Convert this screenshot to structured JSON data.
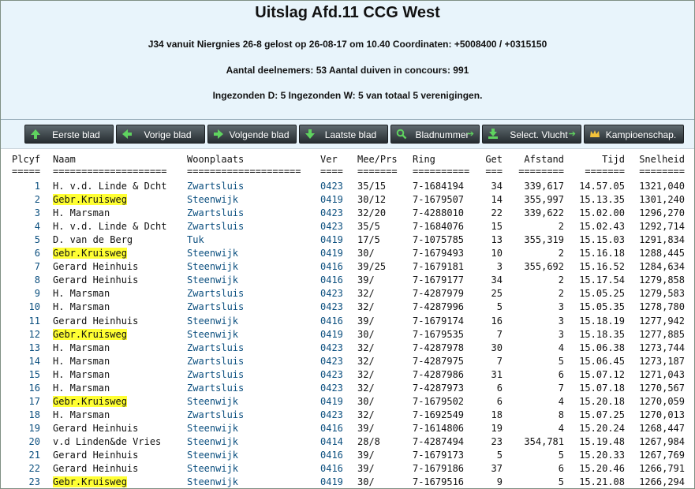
{
  "title": "Uitslag Afd.11 CCG West",
  "info": {
    "line1": "J34 vanuit Niergnies 26-8 gelost op 26-08-17 om 10.40 Coordinaten: +5008400 / +0315150",
    "line2": "Aantal deelnemers: 53 Aantal duiven in concours: 991",
    "line3": "Ingezonden D: 5 Ingezonden W: 5 van totaal 5 verenigingen."
  },
  "nav": {
    "first": "Eerste blad",
    "prev": "Vorige blad",
    "next": "Volgende blad",
    "last": "Laatste blad",
    "page": "Bladnummer",
    "select": "Select. Vlucht",
    "champ": "Kampioenschap."
  },
  "columns": [
    "Plcyf",
    "Naam",
    "Woonplaats",
    "Ver",
    "Mee/Prs",
    "Ring",
    "Get",
    "Afstand",
    "Tijd",
    "Snelheid"
  ],
  "underlines": [
    "=====",
    "====================",
    "====================",
    "====",
    "=======",
    "==========",
    "===",
    "========",
    "=======",
    "========"
  ],
  "rows": [
    [
      "1",
      "H. v.d. Linde & Dcht",
      "Zwartsluis",
      "0423",
      "35/15",
      "7-1684194",
      "34",
      "339,617",
      "14.57.05",
      "1321,040"
    ],
    [
      "2",
      "Gebr.Kruisweg",
      "Steenwijk",
      "0419",
      "30/12",
      "7-1679507",
      "14",
      "355,997",
      "15.13.35",
      "1301,240"
    ],
    [
      "3",
      "H. Marsman",
      "Zwartsluis",
      "0423",
      "32/20",
      "7-4288010",
      "22",
      "339,622",
      "15.02.00",
      "1296,270"
    ],
    [
      "4",
      "H. v.d. Linde & Dcht",
      "Zwartsluis",
      "0423",
      "35/5",
      "7-1684076",
      "15",
      "2",
      "15.02.43",
      "1292,714"
    ],
    [
      "5",
      "D. van de Berg",
      "Tuk",
      "0419",
      "17/5",
      "7-1075785",
      "13",
      "355,319",
      "15.15.03",
      "1291,834"
    ],
    [
      "6",
      "Gebr.Kruisweg",
      "Steenwijk",
      "0419",
      "30/",
      "7-1679493",
      "10",
      "2",
      "15.16.18",
      "1288,445"
    ],
    [
      "7",
      "Gerard Heinhuis",
      "Steenwijk",
      "0416",
      "39/25",
      "7-1679181",
      "3",
      "355,692",
      "15.16.52",
      "1284,634"
    ],
    [
      "8",
      "Gerard Heinhuis",
      "Steenwijk",
      "0416",
      "39/",
      "7-1679177",
      "34",
      "2",
      "15.17.54",
      "1279,858"
    ],
    [
      "9",
      "H. Marsman",
      "Zwartsluis",
      "0423",
      "32/",
      "7-4287979",
      "25",
      "2",
      "15.05.25",
      "1279,583"
    ],
    [
      "10",
      "H. Marsman",
      "Zwartsluis",
      "0423",
      "32/",
      "7-4287996",
      "5",
      "3",
      "15.05.35",
      "1278,780"
    ],
    [
      "11",
      "Gerard Heinhuis",
      "Steenwijk",
      "0416",
      "39/",
      "7-1679174",
      "16",
      "3",
      "15.18.19",
      "1277,942"
    ],
    [
      "12",
      "Gebr.Kruisweg",
      "Steenwijk",
      "0419",
      "30/",
      "7-1679535",
      "7",
      "3",
      "15.18.35",
      "1277,885"
    ],
    [
      "13",
      "H. Marsman",
      "Zwartsluis",
      "0423",
      "32/",
      "7-4287978",
      "30",
      "4",
      "15.06.38",
      "1273,744"
    ],
    [
      "14",
      "H. Marsman",
      "Zwartsluis",
      "0423",
      "32/",
      "7-4287975",
      "7",
      "5",
      "15.06.45",
      "1273,187"
    ],
    [
      "15",
      "H. Marsman",
      "Zwartsluis",
      "0423",
      "32/",
      "7-4287986",
      "31",
      "6",
      "15.07.12",
      "1271,043"
    ],
    [
      "16",
      "H. Marsman",
      "Zwartsluis",
      "0423",
      "32/",
      "7-4287973",
      "6",
      "7",
      "15.07.18",
      "1270,567"
    ],
    [
      "17",
      "Gebr.Kruisweg",
      "Steenwijk",
      "0419",
      "30/",
      "7-1679502",
      "6",
      "4",
      "15.20.18",
      "1270,059"
    ],
    [
      "18",
      "H. Marsman",
      "Zwartsluis",
      "0423",
      "32/",
      "7-1692549",
      "18",
      "8",
      "15.07.25",
      "1270,013"
    ],
    [
      "19",
      "Gerard Heinhuis",
      "Steenwijk",
      "0416",
      "39/",
      "7-1614806",
      "19",
      "4",
      "15.20.24",
      "1268,447"
    ],
    [
      "20",
      "v.d Linden&de Vries",
      "Steenwijk",
      "0414",
      "28/8",
      "7-4287494",
      "23",
      "354,781",
      "15.19.48",
      "1267,984"
    ],
    [
      "21",
      "Gerard Heinhuis",
      "Steenwijk",
      "0416",
      "39/",
      "7-1679173",
      "5",
      "5",
      "15.20.33",
      "1267,769"
    ],
    [
      "22",
      "Gerard Heinhuis",
      "Steenwijk",
      "0416",
      "39/",
      "7-1679186",
      "37",
      "6",
      "15.20.46",
      "1266,791"
    ],
    [
      "23",
      "Gebr.Kruisweg",
      "Steenwijk",
      "0419",
      "30/",
      "7-1679516",
      "9",
      "5",
      "15.21.08",
      "1266,294"
    ]
  ],
  "highlight_name": "Gebr.Kruisweg",
  "colors": {
    "highlight": "#ffff33",
    "link": "#0b4f7f",
    "header_bg": "#e8f4fb"
  }
}
